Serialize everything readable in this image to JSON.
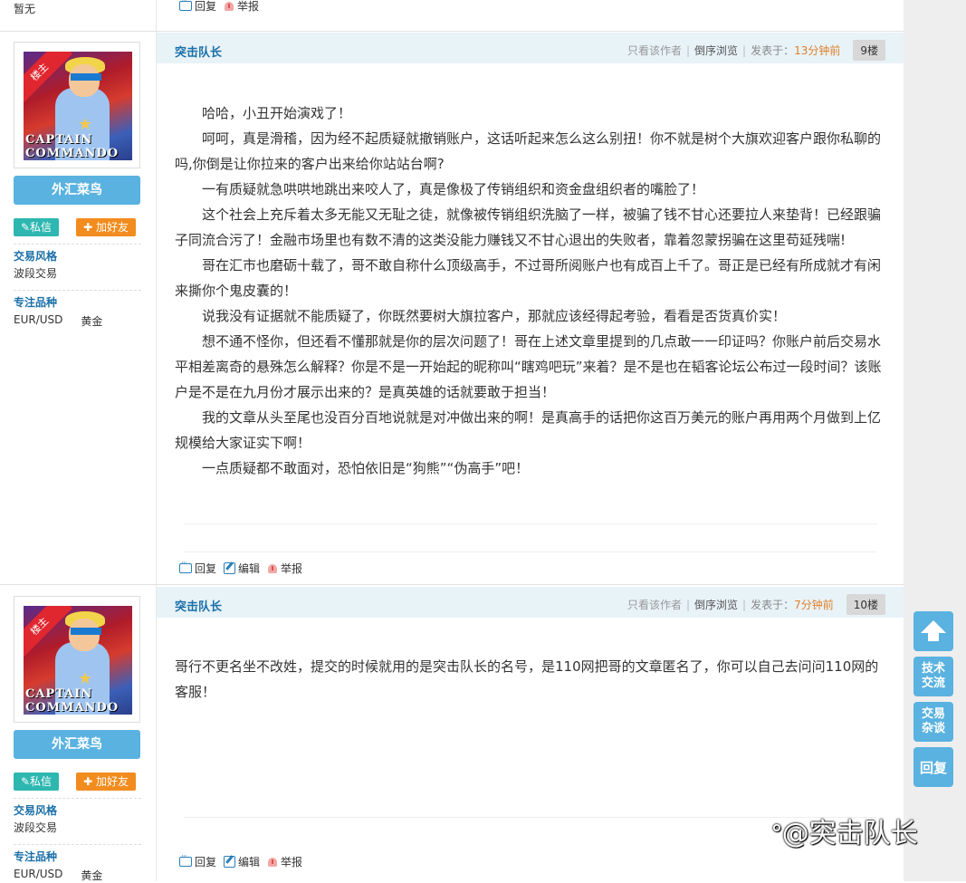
{
  "prev_post": {
    "status_text": "暂无",
    "actions": {
      "reply": "回复",
      "report": "举报"
    }
  },
  "posts": [
    {
      "author": "突击队长",
      "meta": {
        "only_author": "只看该作者",
        "reverse": "倒序浏览",
        "posted_label": "发表于：",
        "time": "13分钟前",
        "floor": "9楼"
      },
      "user": {
        "ribbon": "楼主",
        "avatar_text": "CAPTAIN COMMANDO",
        "name": "外汇菜鸟",
        "msg_btn": "✎私信",
        "friend_btn": "✚ 加好友",
        "style_label": "交易风格",
        "style_value": "波段交易",
        "focus_label": "专注品种",
        "focus_values": [
          "EUR/USD",
          "黄金"
        ]
      },
      "paragraphs": [
        "哈哈，小丑开始演戏了！",
        "呵呵，真是滑稽，因为经不起质疑就撤销账户，这话听起来怎么这么别扭！你不就是树个大旗欢迎客户跟你私聊的吗,你倒是让你拉来的客户出来给你站站台啊?",
        "一有质疑就急哄哄地跳出来咬人了，真是像极了传销组织和资金盘组织者的嘴脸了！",
        "这个社会上充斥着太多无能又无耻之徒，就像被传销组织洗脑了一样，被骗了钱不甘心还要拉人来垫背！已经跟骗子同流合污了！金融市场里也有数不清的这类没能力赚钱又不甘心退出的失败者，靠着忽蒙拐骗在这里苟延残喘!",
        "哥在汇市也磨砺十载了，哥不敢自称什么顶级高手，不过哥所阅账户也有成百上千了。哥正是已经有所成就才有闲来撕你个鬼皮囊的！",
        "说我没有证据就不能质疑了，你既然要树大旗拉客户，那就应该经得起考验，看看是否货真价实！",
        "想不通不怪你，但还看不懂那就是你的层次问题了！哥在上述文章里提到的几点敢一一印证吗？你账户前后交易水平相差离奇的悬殊怎么解释？你是不是一开始起的昵称叫“瞎鸡吧玩”来着？是不是也在韬客论坛公布过一段时间？该账户是不是在九月份才展示出来的？是真英雄的话就要敢于担当！",
        "我的文章从头至尾也没百分百地说就是对冲做出来的啊！是真高手的话把你这百万美元的账户再用两个月做到上亿规模给大家证实下啊！",
        "一点质疑都不敢面对，恐怕依旧是“狗熊”“伪高手”吧！"
      ],
      "actions": {
        "reply": "回复",
        "edit": "编辑",
        "report": "举报"
      }
    },
    {
      "author": "突击队长",
      "meta": {
        "only_author": "只看该作者",
        "reverse": "倒序浏览",
        "posted_label": "发表于：",
        "time": "7分钟前",
        "floor": "10楼"
      },
      "user": {
        "ribbon": "楼主",
        "avatar_text": "CAPTAIN COMMANDO",
        "name": "外汇菜鸟",
        "msg_btn": "✎私信",
        "friend_btn": "✚ 加好友",
        "style_label": "交易风格",
        "style_value": "波段交易",
        "focus_label": "专注品种",
        "focus_values": [
          "EUR/USD",
          "黄金"
        ]
      },
      "paragraphs": [
        "哥行不更名坐不改姓，提交的时候就用的是突击队长的名号，是110网把哥的文章匿名了，你可以自己去问问110网的客服！"
      ],
      "actions": {
        "reply": "回复",
        "edit": "编辑",
        "report": "举报"
      }
    }
  ],
  "float_buttons": {
    "top": "top",
    "tech": "技术交流",
    "chat": "交易杂谈",
    "reply": "回复"
  },
  "watermark": "@突击队长",
  "colors": {
    "accent_blue": "#5ab2e0",
    "author_blue": "#1a6fa8",
    "time_orange": "#e0802a",
    "msg_teal": "#2db7b0",
    "friend_orange": "#f28c1e"
  }
}
